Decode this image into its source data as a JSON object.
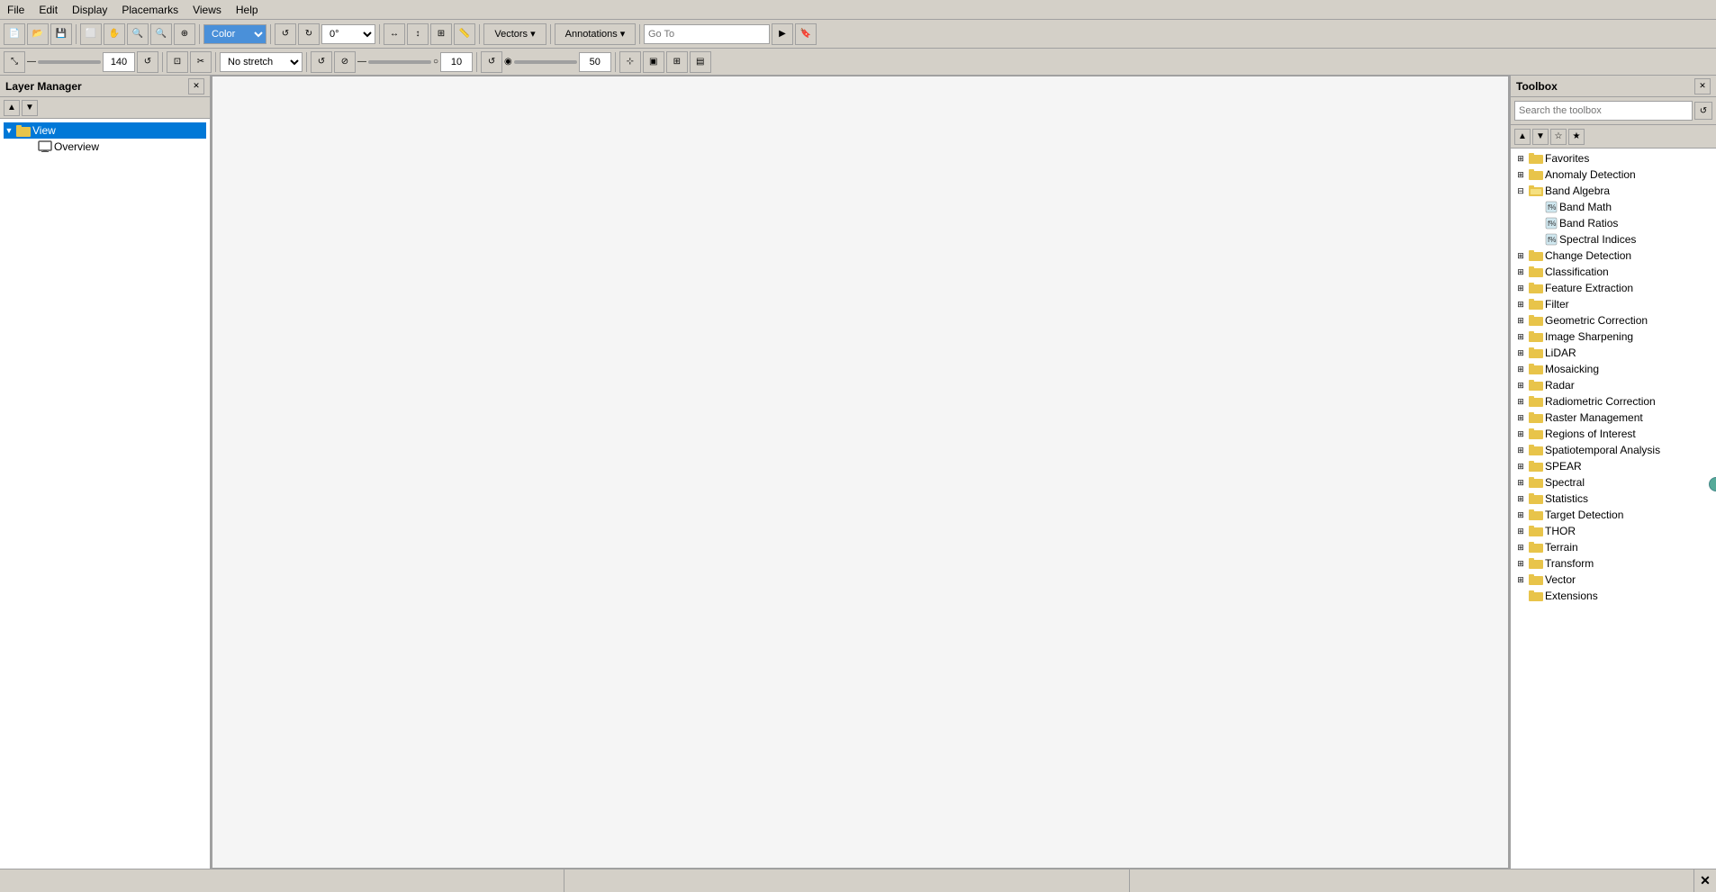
{
  "menubar": {
    "items": [
      "File",
      "Edit",
      "Display",
      "Placemarks",
      "Views",
      "Help"
    ]
  },
  "toolbar1": {
    "angle": "0°",
    "vectors_label": "Vectors ▾",
    "annotations_label": "Annotations ▾",
    "goto_placeholder": "Go To",
    "zoom_value": "140"
  },
  "toolbar2": {
    "stretch_label": "No stretch",
    "value1": "10",
    "value2": "50"
  },
  "layer_manager": {
    "title": "Layer Manager",
    "view_label": "View",
    "overview_label": "Overview"
  },
  "toolbox": {
    "title": "Toolbox",
    "search_placeholder": "Search the toolbox",
    "items": [
      {
        "id": "favorites",
        "label": "Favorites",
        "type": "folder",
        "expanded": false
      },
      {
        "id": "anomaly",
        "label": "Anomaly Detection",
        "type": "folder",
        "expanded": false
      },
      {
        "id": "band-algebra",
        "label": "Band Algebra",
        "type": "folder",
        "expanded": true,
        "children": [
          {
            "id": "band-math",
            "label": "Band Math",
            "type": "tool"
          },
          {
            "id": "band-ratios",
            "label": "Band Ratios",
            "type": "tool"
          },
          {
            "id": "spectral-indices",
            "label": "Spectral Indices",
            "type": "tool"
          }
        ]
      },
      {
        "id": "change-detection",
        "label": "Change Detection",
        "type": "folder",
        "expanded": false
      },
      {
        "id": "classification",
        "label": "Classification",
        "type": "folder",
        "expanded": false
      },
      {
        "id": "feature-extraction",
        "label": "Feature Extraction",
        "type": "folder",
        "expanded": false
      },
      {
        "id": "filter",
        "label": "Filter",
        "type": "folder",
        "expanded": false
      },
      {
        "id": "geometric-correction",
        "label": "Geometric Correction",
        "type": "folder",
        "expanded": false
      },
      {
        "id": "image-sharpening",
        "label": "Image Sharpening",
        "type": "folder",
        "expanded": false
      },
      {
        "id": "lidar",
        "label": "LiDAR",
        "type": "folder",
        "expanded": false
      },
      {
        "id": "mosaicking",
        "label": "Mosaicking",
        "type": "folder",
        "expanded": false
      },
      {
        "id": "radar",
        "label": "Radar",
        "type": "folder",
        "expanded": false
      },
      {
        "id": "radiometric-correction",
        "label": "Radiometric Correction",
        "type": "folder",
        "expanded": false
      },
      {
        "id": "raster-management",
        "label": "Raster Management",
        "type": "folder",
        "expanded": false
      },
      {
        "id": "regions-of-interest",
        "label": "Regions of Interest",
        "type": "folder",
        "expanded": false
      },
      {
        "id": "spatiotemporal",
        "label": "Spatiotemporal Analysis",
        "type": "folder",
        "expanded": false
      },
      {
        "id": "spear",
        "label": "SPEAR",
        "type": "folder",
        "expanded": false
      },
      {
        "id": "spectral",
        "label": "Spectral",
        "type": "folder",
        "expanded": false
      },
      {
        "id": "statistics",
        "label": "Statistics",
        "type": "folder",
        "expanded": false
      },
      {
        "id": "target-detection",
        "label": "Target Detection",
        "type": "folder",
        "expanded": false
      },
      {
        "id": "thor",
        "label": "THOR",
        "type": "folder",
        "expanded": false
      },
      {
        "id": "terrain",
        "label": "Terrain",
        "type": "folder",
        "expanded": false
      },
      {
        "id": "transform",
        "label": "Transform",
        "type": "folder",
        "expanded": false
      },
      {
        "id": "vector",
        "label": "Vector",
        "type": "folder",
        "expanded": false
      },
      {
        "id": "extensions",
        "label": "Extensions",
        "type": "folder",
        "expanded": false
      }
    ]
  },
  "statusbar": {
    "cell1": "",
    "cell2": "",
    "cell3": "",
    "close_label": "✕"
  }
}
